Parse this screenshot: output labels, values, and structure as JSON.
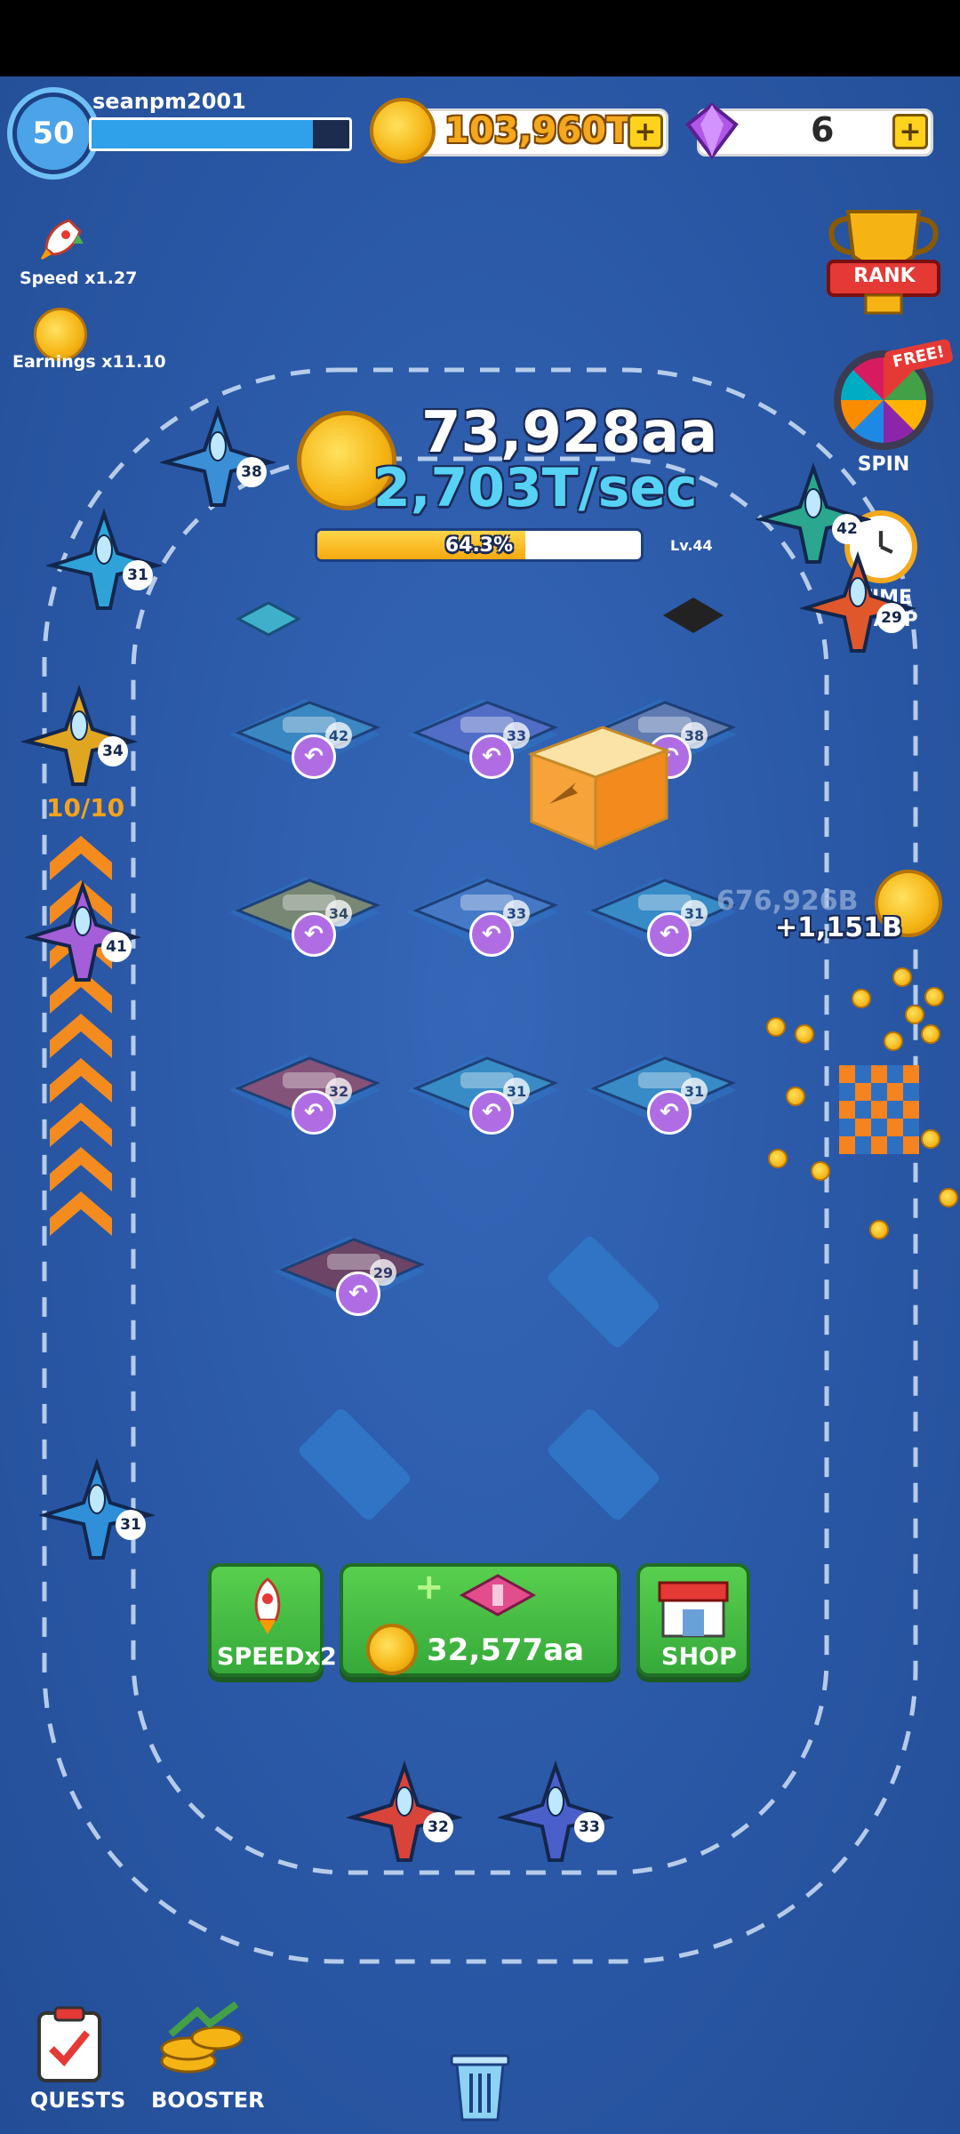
{
  "player": {
    "level": "50",
    "username": "seanpm2001",
    "xp_fraction": 0.86
  },
  "currency": {
    "coins": "103,960T",
    "gems": "6",
    "plus": "+"
  },
  "buffs": {
    "speed_label": "Speed x1.27",
    "earnings_label": "Earnings x11.10"
  },
  "side_menu": {
    "rank_label": "RANK",
    "free_tag": "FREE!",
    "spin_label": "SPIN",
    "time_warp_label": "TIME WARP"
  },
  "earnings": {
    "total": "73,928aa",
    "rate": "2,703T/sec",
    "progress_text": "64.3%",
    "progress_fraction": 0.643,
    "next_level_tag": "Lv.44"
  },
  "runway": {
    "counter": "10/10"
  },
  "floating": {
    "ghost_value": "676,926B",
    "gain_value": "+1,151B"
  },
  "grid": {
    "planes": [
      {
        "level": "42"
      },
      {
        "level": "33"
      },
      {
        "level": "38"
      },
      {
        "level": "34"
      },
      {
        "level": "33"
      },
      {
        "level": "31"
      },
      {
        "level": "32"
      },
      {
        "level": "31"
      },
      {
        "level": "31"
      },
      {
        "level": "29"
      }
    ],
    "return_symbol": "↶"
  },
  "track_planes": {
    "levels": [
      "38",
      "31",
      "34",
      "41",
      "31",
      "32",
      "33",
      "29",
      "42"
    ]
  },
  "actions": {
    "speed_label": "SPEEDx2",
    "buy_cost": "32,577aa",
    "buy_plus": "+",
    "shop_label": "SHOP"
  },
  "bottom_nav": {
    "quests_label": "QUESTS",
    "booster_label": "BOOSTER"
  },
  "colors": {
    "background": "#2b5aa8",
    "coin_gold": "#f4a81c",
    "rate_cyan": "#56d2f5",
    "button_green": "#36a93a",
    "return_purple": "#b06de3"
  }
}
